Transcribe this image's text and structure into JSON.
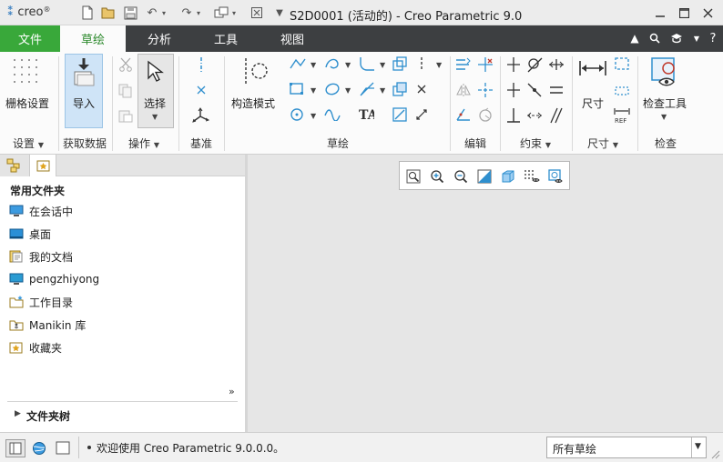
{
  "app": {
    "logo": "creo",
    "window_title": "S2D0001 (活动的) - Creo Parametric 9.0"
  },
  "tabs": [
    {
      "label": "文件"
    },
    {
      "label": "草绘"
    },
    {
      "label": "分析"
    },
    {
      "label": "工具"
    },
    {
      "label": "视图"
    }
  ],
  "ribbon": {
    "groups": {
      "setup": "设置",
      "get_data": "获取数据",
      "operations": "操作",
      "datum": "基准",
      "sketching": "草绘",
      "editing": "编辑",
      "constrain": "约束",
      "dimension": "尺寸",
      "inspect": "检查"
    },
    "buttons": {
      "grid_settings": "栅格设置",
      "import": "导入",
      "select": "选择",
      "construction_mode": "构造模式",
      "dimension": "尺寸",
      "inspect_tools": "检查工具"
    }
  },
  "left_panel": {
    "section_title": "常用文件夹",
    "folders": [
      {
        "label": "在会话中",
        "icon": "session-icon"
      },
      {
        "label": "桌面",
        "icon": "desktop-icon"
      },
      {
        "label": "我的文档",
        "icon": "documents-icon"
      },
      {
        "label": "pengzhiyong",
        "icon": "computer-icon"
      },
      {
        "label": "工作目录",
        "icon": "working-directory-icon"
      },
      {
        "label": "Manikin 库",
        "icon": "library-icon"
      },
      {
        "label": "收藏夹",
        "icon": "favorites-icon"
      }
    ],
    "folder_tree": "文件夹树"
  },
  "status": {
    "message": "欢迎使用 Creo Parametric 9.0.0.0。",
    "filter": "所有草绘"
  },
  "colors": {
    "file_tab": "#39a83a",
    "tab_bar": "#3d3f41",
    "accent_blue": "#2f8fce"
  }
}
